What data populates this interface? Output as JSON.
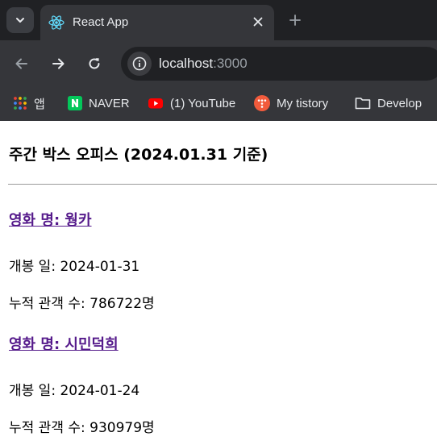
{
  "browser": {
    "tab": {
      "title": "React App",
      "favicon": "react-logo-icon"
    },
    "address": {
      "host": "localhost",
      "port": ":3000"
    },
    "bookmarks": [
      {
        "label": "앱",
        "icon": "apps-grid-icon"
      },
      {
        "label": "NAVER",
        "icon": "naver-logo-icon"
      },
      {
        "label": "(1) YouTube",
        "icon": "youtube-logo-icon"
      },
      {
        "label": "My tistory",
        "icon": "tistory-logo-icon"
      },
      {
        "label": "Develop",
        "icon": "folder-icon"
      }
    ]
  },
  "page": {
    "title": "주간 박스 오피스 (2024.01.31 기준)",
    "movies": [
      {
        "name": "영화 명: 웡카",
        "release": "개봉 일: 2024-01-31",
        "audience": "누적 관객 수: 786722명"
      },
      {
        "name": "영화 명: 시민덕희",
        "release": "개봉 일: 2024-01-24",
        "audience": "누적 관객 수: 930979명"
      }
    ]
  },
  "colors": {
    "chrome_dark": "#202124",
    "chrome": "#35363a",
    "link_visited": "#551a8b",
    "naver_green": "#03c75a",
    "youtube_red": "#ff0000",
    "tistory_orange": "#f25b3c"
  }
}
